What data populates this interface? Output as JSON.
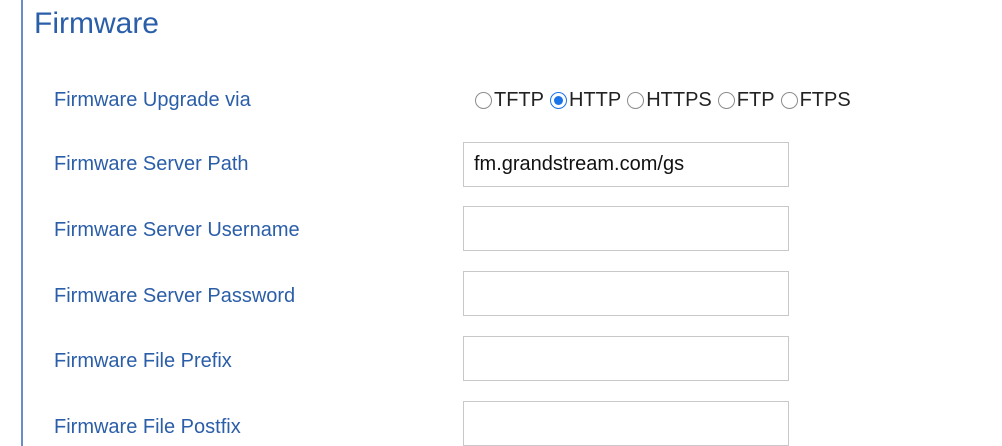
{
  "section": {
    "title": "Firmware"
  },
  "upgrade_via": {
    "label": "Firmware Upgrade via",
    "options": [
      {
        "label": "TFTP",
        "checked": false
      },
      {
        "label": "HTTP",
        "checked": true
      },
      {
        "label": "HTTPS",
        "checked": false
      },
      {
        "label": "FTP",
        "checked": false
      },
      {
        "label": "FTPS",
        "checked": false
      }
    ]
  },
  "server_path": {
    "label": "Firmware Server Path",
    "value": "fm.grandstream.com/gs"
  },
  "server_username": {
    "label": "Firmware Server Username",
    "value": ""
  },
  "server_password": {
    "label": "Firmware Server Password",
    "value": ""
  },
  "file_prefix": {
    "label": "Firmware File Prefix",
    "value": ""
  },
  "file_postfix": {
    "label": "Firmware File Postfix",
    "value": ""
  }
}
